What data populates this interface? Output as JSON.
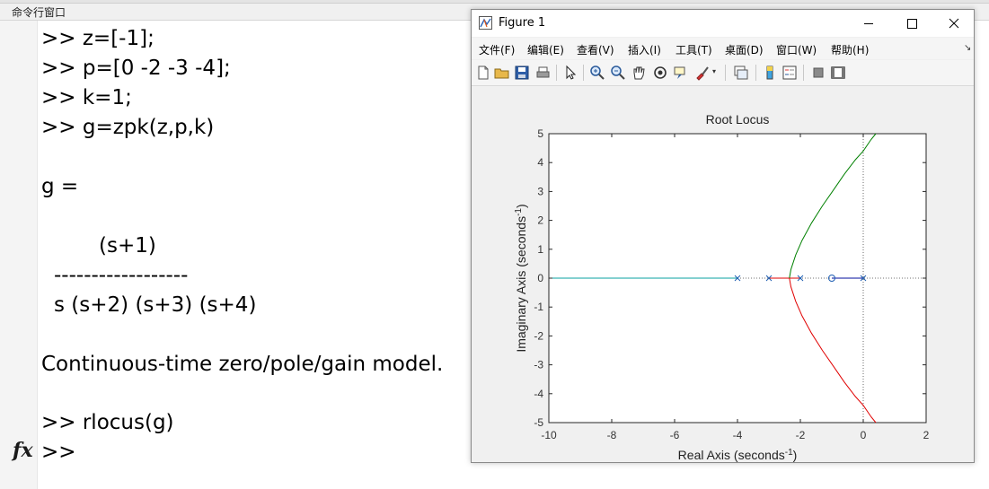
{
  "command_window": {
    "title": "命令行窗口",
    "lines": [
      ">> z=[-1];",
      ">> p=[0 -2 -3 -4];",
      ">> k=1;",
      ">> g=zpk(z,p,k)",
      "g =",
      "(s+1)",
      "------------------",
      "s (s+2) (s+3) (s+4)",
      "Continuous-time zero/pole/gain model.",
      ">> rlocus(g)",
      ">>"
    ],
    "prompt_icon": "fx-icon"
  },
  "figure": {
    "title": "Figure 1",
    "window_buttons": [
      "minimize-icon",
      "maximize-icon",
      "close-icon"
    ],
    "menu": [
      "文件(F)",
      "编辑(E)",
      "查看(V)",
      "插入(I)",
      "工具(T)",
      "桌面(D)",
      "窗口(W)",
      "帮助(H)"
    ],
    "toolbar_icons": [
      "new-figure-icon",
      "open-file-icon",
      "save-icon",
      "print-icon",
      "select-arrow-icon",
      "zoom-in-icon",
      "zoom-out-icon",
      "pan-hand-icon",
      "rotate-3d-icon",
      "data-cursor-icon",
      "brush-icon",
      "link-plot-icon",
      "colorbar-icon",
      "legend-icon",
      "hide-plot-tools-icon",
      "show-plot-tools-icon"
    ]
  },
  "chart_data": {
    "type": "line",
    "title": "Root Locus",
    "xlabel": "Real Axis (seconds",
    "xlabel_sup": "-1",
    "xlabel_end": ")",
    "ylabel": "Imaginary Axis (seconds",
    "ylabel_sup": "-1",
    "ylabel_end": ")",
    "xlim": [
      -10,
      2
    ],
    "ylim": [
      -5,
      5
    ],
    "xticks": [
      "-10",
      "-8",
      "-6",
      "-4",
      "-2",
      "0",
      "2"
    ],
    "yticks": [
      "5",
      "4",
      "3",
      "2",
      "1",
      "0",
      "-1",
      "-2",
      "-3",
      "-4",
      "-5"
    ],
    "grid": false,
    "colors": {
      "cyan": "#0aa1a1",
      "blue": "#000d9e",
      "red": "#e00000",
      "green": "#008000",
      "marker": "#1f5fb3"
    },
    "poles": [
      [
        0,
        0
      ],
      [
        -2,
        0
      ],
      [
        -3,
        0
      ],
      [
        -4,
        0
      ]
    ],
    "zeros": [
      [
        -1,
        0
      ]
    ],
    "series": [
      {
        "color": "cyan",
        "x": [
          -10,
          -4
        ],
        "y": [
          0,
          0
        ]
      },
      {
        "color": "blue",
        "x": [
          -1,
          0
        ],
        "y": [
          0,
          0
        ]
      },
      {
        "color": "red",
        "x": [
          -3,
          -2.35
        ],
        "y": [
          0,
          0
        ]
      },
      {
        "color": "red",
        "x": [
          -2,
          -2.35
        ],
        "y": [
          0,
          0
        ]
      },
      {
        "color": "red",
        "x": [
          -2.35,
          -2.3,
          -2.15,
          -1.95,
          -1.65,
          -1.3,
          -0.95,
          -0.6,
          -0.25,
          0.0,
          0.25,
          0.4
        ],
        "y": [
          0,
          -0.3,
          -0.8,
          -1.3,
          -1.9,
          -2.5,
          -3.05,
          -3.6,
          -4.1,
          -4.4,
          -4.8,
          -5.0
        ]
      },
      {
        "color": "green",
        "x": [
          -2.35,
          -2.3,
          -2.15,
          -1.95,
          -1.65,
          -1.3,
          -0.95,
          -0.6,
          -0.25,
          0.0,
          0.25,
          0.4
        ],
        "y": [
          0,
          0.3,
          0.8,
          1.3,
          1.9,
          2.5,
          3.05,
          3.6,
          4.1,
          4.4,
          4.8,
          5.0
        ]
      }
    ]
  }
}
